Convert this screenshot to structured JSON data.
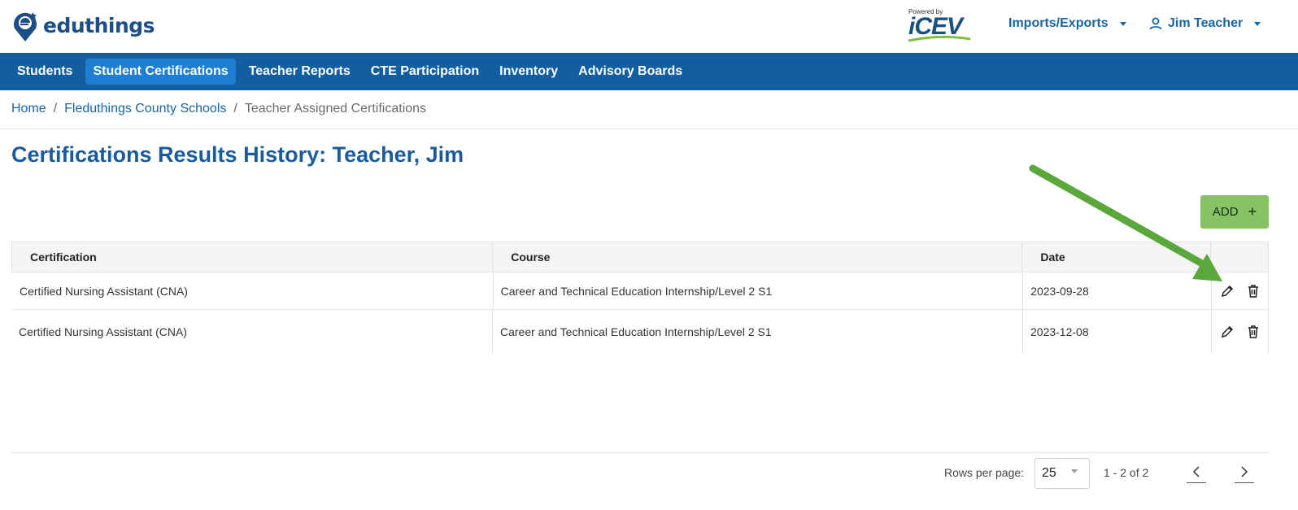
{
  "header": {
    "brand": "eduthings",
    "powered_by": "Powered by",
    "partner_logo_text": "iCEV",
    "imports_menu_label": "Imports/Exports",
    "user_menu_label": "Jim Teacher"
  },
  "nav": {
    "items": [
      {
        "label": "Students",
        "active": false
      },
      {
        "label": "Student Certifications",
        "active": true
      },
      {
        "label": "Teacher Reports",
        "active": false
      },
      {
        "label": "CTE Participation",
        "active": false
      },
      {
        "label": "Inventory",
        "active": false
      },
      {
        "label": "Advisory Boards",
        "active": false
      }
    ]
  },
  "breadcrumb": {
    "home": "Home",
    "district": "Fleduthings County Schools",
    "current": "Teacher Assigned Certifications",
    "separator": "/"
  },
  "page": {
    "title": "Certifications Results History: Teacher, Jim",
    "add_button_label": "ADD",
    "add_button_icon": "+"
  },
  "table": {
    "columns": [
      "Certification",
      "Course",
      "Date",
      ""
    ],
    "rows": [
      {
        "certification": "Certified Nursing Assistant (CNA)",
        "course": "Career and Technical Education Internship/Level 2 S1",
        "date": "2023-09-28"
      },
      {
        "certification": "Certified Nursing Assistant (CNA)",
        "course": "Career and Technical Education Internship/Level 2 S1",
        "date": "2023-12-08"
      }
    ]
  },
  "pagination": {
    "rows_per_page_label": "Rows per page:",
    "rows_per_page_value": "25",
    "range_text": "1 - 2 of 2"
  },
  "colors": {
    "nav_bg": "#135da1",
    "nav_active": "#1f7ed2",
    "title": "#1a5c9b",
    "link": "#1565a8",
    "add_button": "#86c463",
    "annotation_arrow": "#5aa83b"
  },
  "icons": {
    "edit": "pencil-icon",
    "delete": "trash-icon",
    "user": "user-icon",
    "prev": "chevron-left-icon",
    "next": "chevron-right-icon"
  }
}
